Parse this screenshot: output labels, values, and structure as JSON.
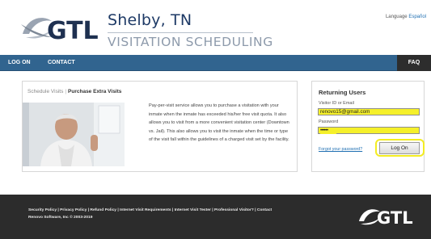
{
  "header": {
    "logo_text": "GTL",
    "city": "Shelby, TN",
    "subtitle": "VISITATION SCHEDULING",
    "language_label": "Language",
    "language_link": "Español"
  },
  "nav": {
    "items": [
      {
        "label": "LOG ON"
      },
      {
        "label": "CONTACT"
      }
    ],
    "faq": "FAQ"
  },
  "main": {
    "tab_schedule": "Schedule Visits",
    "tab_separator": "|",
    "tab_purchase": "Purchase Extra Visits",
    "description": "Pay-per-visit service allows you to purchase a visitation with your inmate when the inmate has exceeded his/her free visit quota. It also allows you to visit from a more convenient visitation center (Downtown vs. Jail). This also allows you to visit the inmate when the time or type of the visit fall within the guidelines of a charged visit set by the facility."
  },
  "login": {
    "title": "Returning Users",
    "visitor_label": "Visitor ID or Email",
    "visitor_value": "renovo15@gmail.com",
    "password_label": "Password",
    "password_value": "••••••",
    "forgot_link": "Forgot your password?",
    "button_label": "Log On",
    "highlight_color": "#f5f02a"
  },
  "footer": {
    "links": "Security Policy | Privacy Policy | Refund Policy | Internet Visit Requirements | Internet Visit Tester | Professional Visitor? | Contact",
    "copyright": "Renovo Software, Inc © 2003-2019",
    "logo_text": "GTL"
  },
  "colors": {
    "nav_bar": "#31648f",
    "faq_tab": "#2d2d2d",
    "footer": "#2c2c2c",
    "link": "#1f6fb2"
  }
}
